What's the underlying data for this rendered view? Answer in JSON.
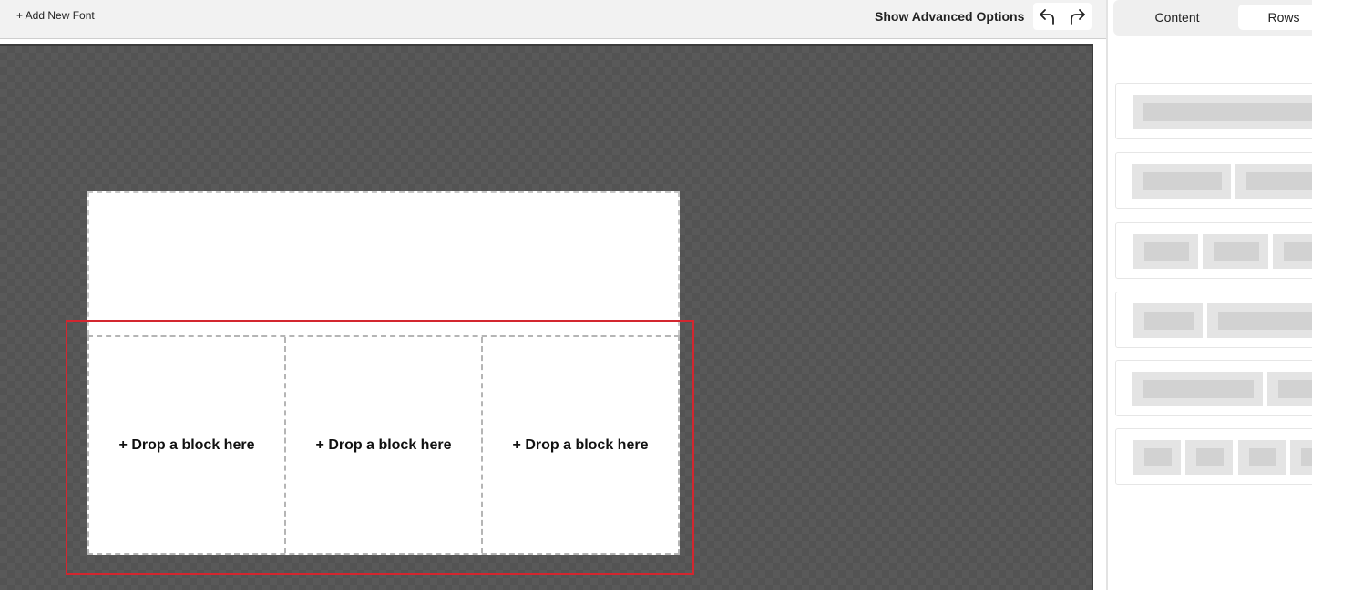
{
  "toolbar": {
    "add_font_label": "+ Add New Font",
    "advanced_options_label": "Show Advanced Options"
  },
  "canvas": {
    "drop_labels": [
      "+ Drop a block here",
      "+ Drop a block here",
      "+ Drop a block here"
    ]
  },
  "panel": {
    "tabs": [
      {
        "label": "Content"
      },
      {
        "label": "Rows"
      }
    ]
  },
  "colors": {
    "selection": "#d3262f",
    "canvas_bg": "#595959"
  },
  "icons": [
    "undo-icon",
    "redo-icon"
  ]
}
